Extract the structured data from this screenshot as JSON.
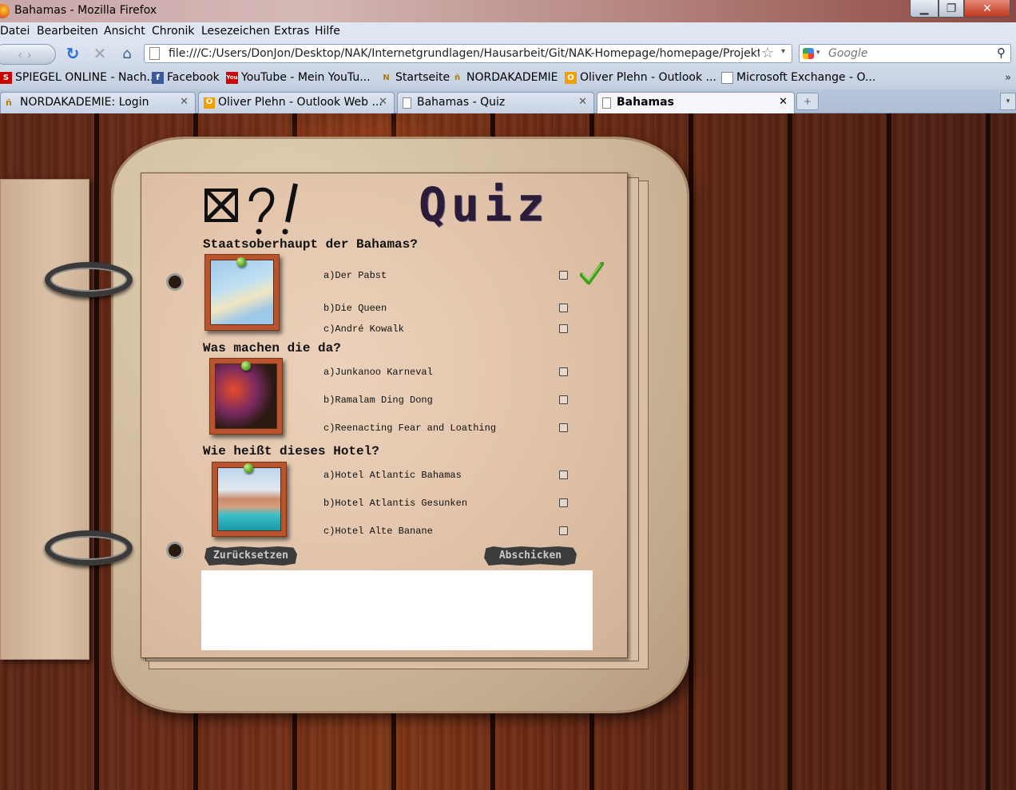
{
  "window": {
    "title": "Bahamas - Mozilla Firefox",
    "min_glyph": "▁",
    "max_glyph": "❐",
    "close_glyph": "✕"
  },
  "menu": [
    "Datei",
    "Bearbeiten",
    "Ansicht",
    "Chronik",
    "Lesezeichen",
    "Extras",
    "Hilfe"
  ],
  "nav": {
    "back_glyph": "‹ ›",
    "reload_glyph": "↻",
    "stop_glyph": "✕",
    "home_glyph": "⌂",
    "url": "file:///C:/Users/DonJon/Desktop/NAK/Internetgrundlagen/Hausarbeit/Git/NAK-Homepage/homepage/Projekt/l",
    "search_placeholder": "Google"
  },
  "bookmarks": [
    {
      "label": "SPIEGEL ONLINE - Nach...",
      "icon": "spiegel-icon"
    },
    {
      "label": "Facebook",
      "icon": "facebook-icon"
    },
    {
      "label": "YouTube - Mein YouTu...",
      "icon": "youtube-icon"
    },
    {
      "label": "Startseite",
      "icon": "nak-icon"
    },
    {
      "label": "NORDAKADEMIE",
      "icon": "nak-icon"
    },
    {
      "label": "Oliver Plehn - Outlook ...",
      "icon": "outlook-icon"
    },
    {
      "label": "Microsoft Exchange - O...",
      "icon": "page-icon"
    }
  ],
  "bookmarks_more": "»",
  "tabs": [
    {
      "label": "NORDAKADEMIE: Login",
      "active": false
    },
    {
      "label": "Oliver Plehn - Outlook Web ...",
      "active": false
    },
    {
      "label": "Bahamas - Quiz",
      "active": false
    },
    {
      "label": "Bahamas",
      "active": true
    }
  ],
  "tab_close_glyph": "✕",
  "tab_new_glyph": "+",
  "tab_list_glyph": "▾",
  "quiz": {
    "title": "Quiz",
    "questions": [
      {
        "question": "Staatsoberhaupt der Bahamas?",
        "image": "map of the Bahamas",
        "answers": [
          "a)Der Pabst",
          "b)Die Queen",
          "c)André Kowalk"
        ]
      },
      {
        "question": "Was machen die da?",
        "image": "carnival photo",
        "answers": [
          "a)Junkanoo Karneval",
          "b)Ramalam Ding Dong",
          "c)Reenacting Fear and Loathing"
        ]
      },
      {
        "question": "Wie heißt dieses Hotel?",
        "image": "hotel photo",
        "answers": [
          "a)Hotel Atlantic Bahamas",
          "b)Hotel Atlantis Gesunken",
          "c)Hotel Alte Banane"
        ]
      }
    ],
    "reset_label": "Zurücksetzen",
    "submit_label": "Abschicken"
  },
  "colors": {
    "wood": "#6d2c18",
    "paper": "#e0c2a8",
    "check_green": "#3f9e1e"
  }
}
